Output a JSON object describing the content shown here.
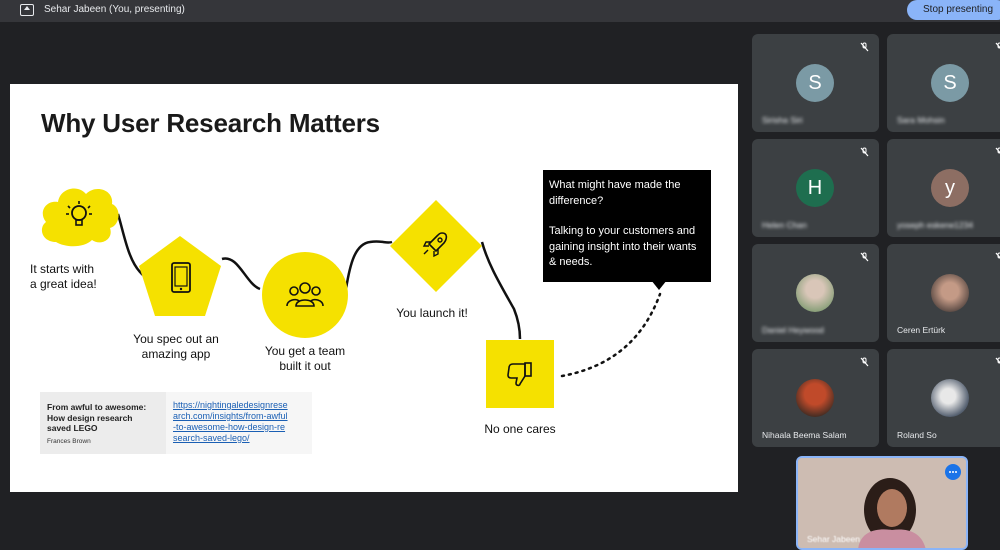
{
  "topbar": {
    "presenter": "Sehar Jabeen (You, presenting)",
    "stop_label": "Stop presenting"
  },
  "slide": {
    "title": "Why User Research Matters",
    "steps": [
      {
        "label_lines": [
          "It starts with",
          "a great idea!"
        ],
        "icon": "lightbulb-icon"
      },
      {
        "label_lines": [
          "You spec out an",
          "amazing app"
        ],
        "icon": "tablet-icon"
      },
      {
        "label_lines": [
          "You get a team",
          "built it out"
        ],
        "icon": "team-icon"
      },
      {
        "label_lines": [
          "You launch it!"
        ],
        "icon": "rocket-icon"
      },
      {
        "label_lines": [
          "No one cares"
        ],
        "icon": "thumbs-down-icon"
      }
    ],
    "callout": {
      "question": "What might have made the difference?",
      "answer": "Talking to your customers and gaining insight into their wants & needs."
    },
    "reference": {
      "title": "From awful to awesome: How design research saved LEGO",
      "author": "Frances Brown",
      "link": "https://nightingaledesignresearch.com/insights/from-awful-to-awesome-how-design-research-saved-lego/",
      "link_lines": [
        "https://nightingaledesignrese",
        "arch.com/insights/from-awful",
        "-to-awesome-how-design-re",
        "search-saved-lego/"
      ]
    },
    "accent_color": "#f5e100"
  },
  "participants": [
    {
      "name": "Sirisha Siri",
      "initial": "S",
      "avatar_color": "#7b9aa5"
    },
    {
      "name": "Sara Mohsin",
      "initial": "S",
      "avatar_color": "#7b9aa5"
    },
    {
      "name": "Helen Chan",
      "initial": "H",
      "avatar_color": "#1e6e4f"
    },
    {
      "name": "yoseph eskene1234",
      "initial": "y",
      "avatar_color": "#8d6e63"
    },
    {
      "name": "Daniel Heywood",
      "initial": "",
      "avatar_color": "#b8a89a"
    },
    {
      "name": "Ceren Ertürk",
      "initial": "",
      "avatar_color": "#a07d6a"
    },
    {
      "name": "Nihaala Beema Salam",
      "initial": "",
      "avatar_color": "#c04a2a"
    },
    {
      "name": "Roland So",
      "initial": "",
      "avatar_color": "#556070"
    }
  ],
  "self_view": {
    "name": "Sehar Jabeen"
  }
}
